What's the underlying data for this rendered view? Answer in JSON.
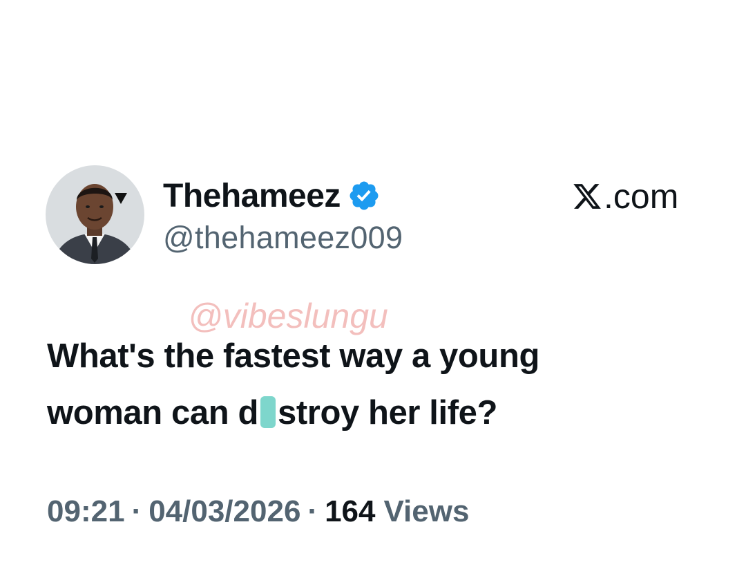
{
  "post": {
    "author": {
      "display_name": "Thehameez",
      "handle": "@thehameez009",
      "verified": true
    },
    "site_label": ".com",
    "watermark": "@vibeslungu",
    "text": {
      "line1": "What's the fastest way a young",
      "line2_prefix": "woman can d",
      "line2_suffix": "stroy her life?"
    },
    "meta": {
      "time": "09:21",
      "separator": "·",
      "date": "04/03/2026",
      "views_count": "164",
      "views_label": "Views"
    }
  },
  "colors": {
    "text_primary": "#0f1419",
    "text_secondary": "#536471",
    "verified_blue": "#1d9bf0",
    "watermark": "#f1b5b2",
    "censor": "#7ed6cc"
  },
  "icons": {
    "avatar": "avatar-photo",
    "verified": "verified-badge-icon",
    "site_logo": "x-logo-icon"
  }
}
